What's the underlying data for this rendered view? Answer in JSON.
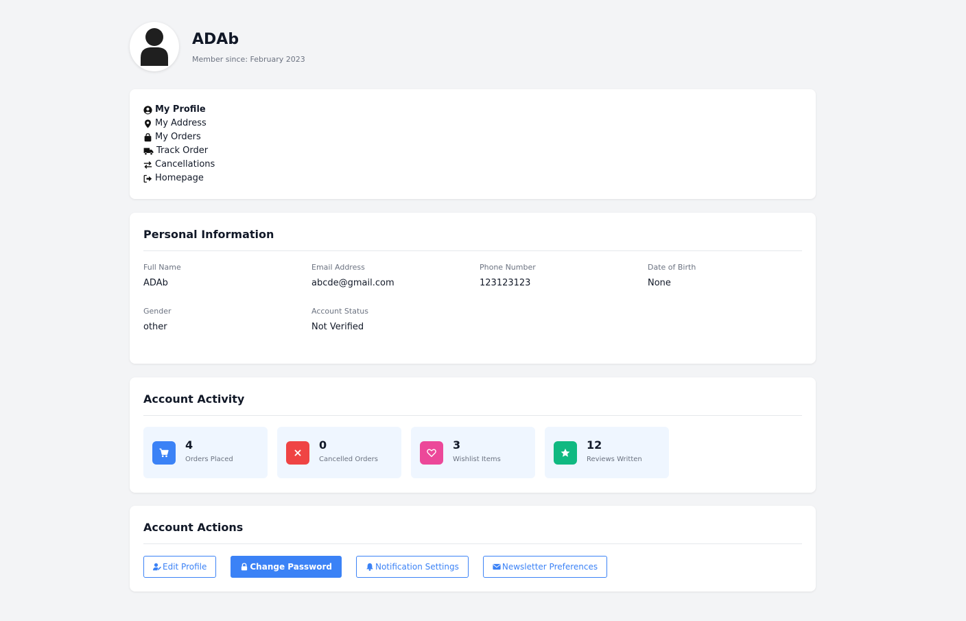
{
  "user": {
    "name": "ADAb",
    "member_since": "Member since: February 2023"
  },
  "nav": {
    "items": [
      {
        "label": "My Profile",
        "icon": "user-circle-icon",
        "active": true
      },
      {
        "label": "My Address",
        "icon": "map-pin-icon",
        "active": false
      },
      {
        "label": "My Orders",
        "icon": "shopping-bag-icon",
        "active": false
      },
      {
        "label": "Track Order",
        "icon": "truck-icon",
        "active": false
      },
      {
        "label": "Cancellations",
        "icon": "exchange-icon",
        "active": false
      },
      {
        "label": "Homepage",
        "icon": "sign-out-icon",
        "active": false
      }
    ]
  },
  "personal_info": {
    "title": "Personal Information",
    "fields": [
      {
        "label": "Full Name",
        "value": "ADAb"
      },
      {
        "label": "Email Address",
        "value": "abcde@gmail.com"
      },
      {
        "label": "Phone Number",
        "value": "123123123"
      },
      {
        "label": "Date of Birth",
        "value": "None"
      },
      {
        "label": "Gender",
        "value": "other"
      },
      {
        "label": "Account Status",
        "value": "Not Verified"
      }
    ]
  },
  "activity": {
    "title": "Account Activity",
    "stats": [
      {
        "value": "4",
        "label": "Orders Placed",
        "icon": "cart-icon",
        "color": "#3b82f6"
      },
      {
        "value": "0",
        "label": "Cancelled Orders",
        "icon": "x-icon",
        "color": "#ef4444"
      },
      {
        "value": "3",
        "label": "Wishlist Items",
        "icon": "heart-icon",
        "color": "#ec4899"
      },
      {
        "value": "12",
        "label": "Reviews Written",
        "icon": "star-icon",
        "color": "#10b981"
      }
    ]
  },
  "actions": {
    "title": "Account Actions",
    "buttons": [
      {
        "label": "Edit Profile",
        "icon": "user-edit-icon",
        "primary": false
      },
      {
        "label": "Change Password",
        "icon": "lock-icon",
        "primary": true
      },
      {
        "label": "Notification Settings",
        "icon": "bell-icon",
        "primary": false
      },
      {
        "label": "Newsletter Preferences",
        "icon": "envelope-icon",
        "primary": false
      }
    ]
  },
  "colors": {
    "accent": "#3b82f6",
    "background": "#f3f4f6",
    "stat_background": "#eff6ff"
  }
}
